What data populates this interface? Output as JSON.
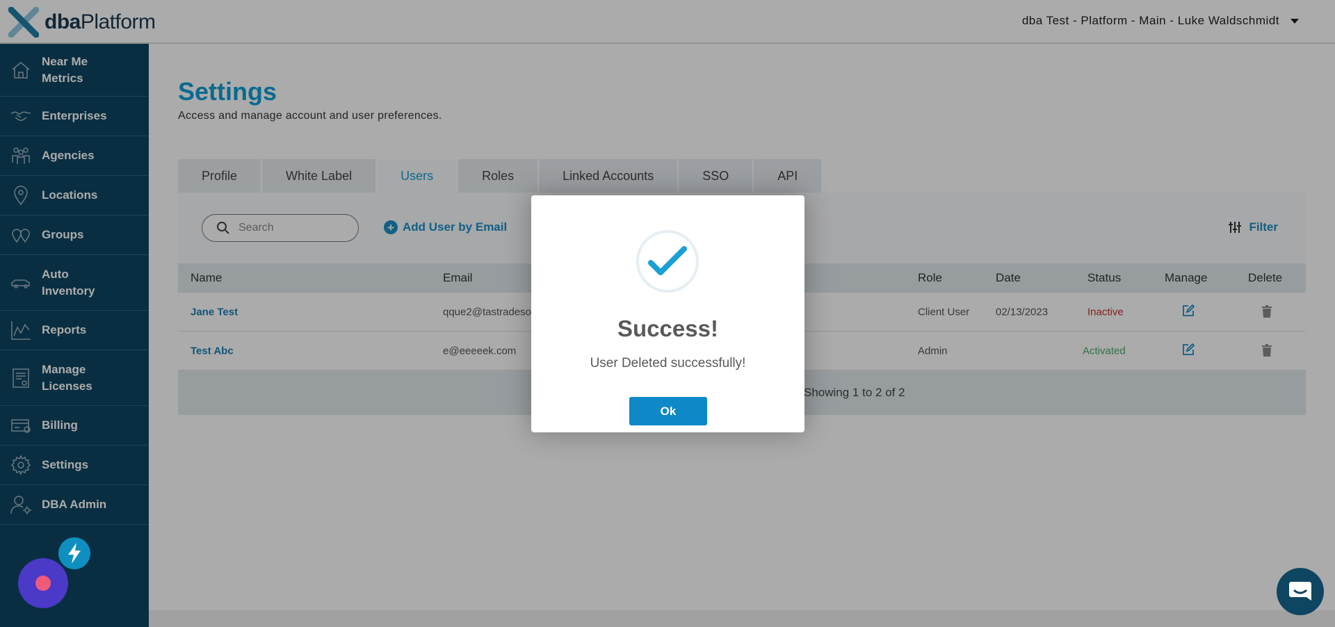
{
  "header": {
    "logo_bold": "dba",
    "logo_light": "Platform",
    "account_label": "dba Test - Platform - Main - Luke Waldschmidt"
  },
  "sidebar": {
    "items": [
      {
        "label": "Near Me Metrics",
        "icon": "home-icon"
      },
      {
        "label": "Enterprises",
        "icon": "handshake-icon"
      },
      {
        "label": "Agencies",
        "icon": "people-icon"
      },
      {
        "label": "Locations",
        "icon": "map-pin-icon"
      },
      {
        "label": "Groups",
        "icon": "group-pins-icon"
      },
      {
        "label": "Auto Inventory",
        "icon": "car-icon"
      },
      {
        "label": "Reports",
        "icon": "chart-icon"
      },
      {
        "label": "Manage Licenses",
        "icon": "license-icon"
      },
      {
        "label": "Billing",
        "icon": "billing-icon"
      },
      {
        "label": "Settings",
        "icon": "gear-icon"
      },
      {
        "label": "DBA Admin",
        "icon": "admin-user-icon"
      }
    ]
  },
  "page": {
    "title": "Settings",
    "subtitle": "Access and manage account and user preferences."
  },
  "tabs": [
    {
      "label": "Profile",
      "active": false
    },
    {
      "label": "White Label",
      "active": false
    },
    {
      "label": "Users",
      "active": true
    },
    {
      "label": "Roles",
      "active": false
    },
    {
      "label": "Linked Accounts",
      "active": false
    },
    {
      "label": "SSO",
      "active": false
    },
    {
      "label": "API",
      "active": false
    }
  ],
  "toolbar": {
    "search_placeholder": "Search",
    "add_user_label": "Add User by Email",
    "filter_label": "Filter"
  },
  "table": {
    "columns": [
      "Name",
      "Email",
      "Role",
      "Date",
      "Status",
      "Manage",
      "Delete"
    ],
    "rows": [
      {
        "name": "Jane Test",
        "email": "qque2@tastradesoft.",
        "role": "Client User",
        "date": "02/13/2023",
        "status": "Inactive"
      },
      {
        "name": "Test Abc",
        "email": "e@eeeeek.com",
        "role": "Admin",
        "date": "",
        "status": "Activated"
      }
    ],
    "footer": "Showing 1 to 2 of 2"
  },
  "modal": {
    "title": "Success!",
    "message": "User Deleted successfully!",
    "ok_label": "Ok"
  },
  "colors": {
    "brand_blue": "#0f9ed5",
    "sidebar_bg": "#0e4561",
    "inactive": "#c23030",
    "activated": "#4aa86a"
  }
}
